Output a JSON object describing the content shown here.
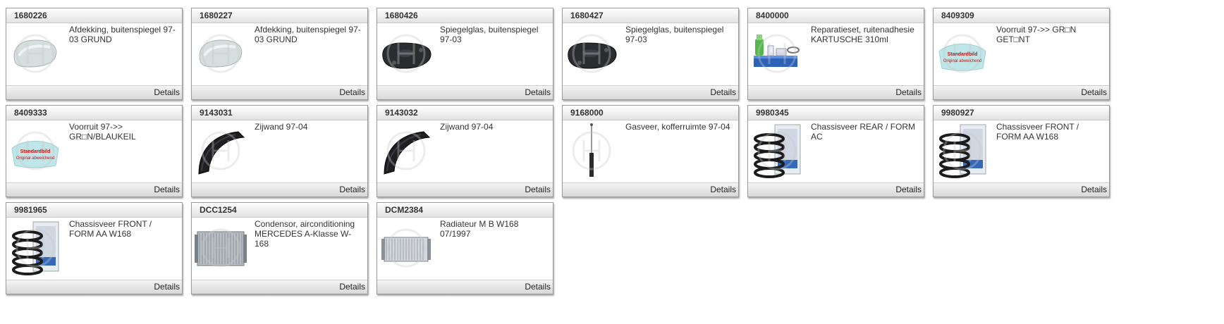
{
  "footer_label": "Details",
  "products": [
    {
      "code": "1680226",
      "name": "Afdekking, buitenspiegel 97-03 GRUND",
      "icon": "mirror-cover-icon"
    },
    {
      "code": "1680227",
      "name": "Afdekking, buitenspiegel 97-03 GRUND",
      "icon": "mirror-cover-icon"
    },
    {
      "code": "1680426",
      "name": "Spiegelglas, buitenspiegel 97-03",
      "icon": "mirror-glass-icon"
    },
    {
      "code": "1680427",
      "name": "Spiegelglas, buitenspiegel 97-03",
      "icon": "mirror-glass-icon"
    },
    {
      "code": "8400000",
      "name": "Reparatieset, ruitenadhesie KARTUSCHE 310ml",
      "icon": "repair-kit-icon"
    },
    {
      "code": "8409309",
      "name": "Voorruit 97->> GR□N GET□NT",
      "icon": "windshield-placeholder-icon",
      "stamp_1": "Standardbild",
      "stamp_2": "Original abweichend"
    },
    {
      "code": "8409333",
      "name": "Voorruit 97->> GR□N/BLAUKEIL",
      "icon": "windshield-placeholder-icon",
      "stamp_1": "Standardbild",
      "stamp_2": "Original abweichend"
    },
    {
      "code": "9143031",
      "name": "Zijwand 97-04",
      "icon": "side-panel-icon"
    },
    {
      "code": "9143032",
      "name": "Zijwand 97-04",
      "icon": "side-panel-icon"
    },
    {
      "code": "9168000",
      "name": "Gasveer, kofferruimte 97-04",
      "icon": "gas-spring-icon"
    },
    {
      "code": "9980345",
      "name": "Chassisveer REAR / FORM AC",
      "icon": "coil-spring-box-icon"
    },
    {
      "code": "9980927",
      "name": "Chassisveer FRONT / FORM AA W168",
      "icon": "coil-spring-box-icon"
    },
    {
      "code": "9981965",
      "name": "Chassisveer FRONT / FORM AA W168",
      "icon": "coil-spring-box-icon"
    },
    {
      "code": "DCC1254",
      "name": "Condensor, airconditioning MERCEDES A-Klasse W-168",
      "icon": "condenser-icon"
    },
    {
      "code": "DCM2384",
      "name": "Radiateur M B W168 07/1997",
      "icon": "radiator-icon"
    }
  ]
}
